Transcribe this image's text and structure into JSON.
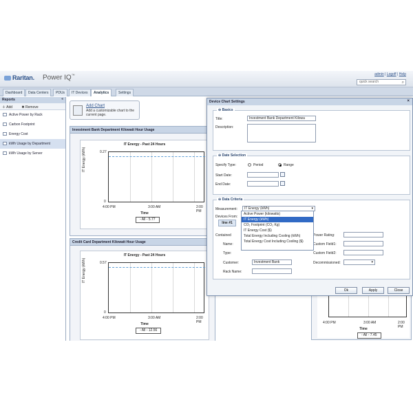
{
  "header": {
    "brand": "Raritan.",
    "product": "Power IQ",
    "trademark": "™",
    "links": [
      "admin",
      "Logoff",
      "Help"
    ],
    "search_placeholder": "quick search"
  },
  "tabs": [
    "Dashboard",
    "Data Centers",
    "PDUs",
    "IT Devices",
    "Analytics",
    "Settings"
  ],
  "sidebar": {
    "title": "Reports",
    "toolbar": {
      "add": "Add",
      "remove": "Remove"
    },
    "items": [
      "Active Power by Rack",
      "Carbon Footprint",
      "Energy Cost",
      "kWh Usage by Department",
      "kWh Usage by Server"
    ]
  },
  "add_chart": {
    "title": "Add Chart",
    "description": "Add a customizable chart to the current page."
  },
  "panels": [
    {
      "title": "Investment Bank Department Kilowatt Hour Usage",
      "chart_title": "IT Energy - Past 24 Hours",
      "y_label": "IT Energy (kWh)",
      "x_label": "Time",
      "y_ticks": [
        "0.27",
        "0"
      ],
      "x_ticks": [
        "4:00 PM",
        "3:00 AM",
        "2:00 PM"
      ],
      "summary": "- All - 5.77"
    },
    {
      "title": "Credit Card Department Kilowatt Hour Usage",
      "chart_title": "IT Energy - Past 24 Hours",
      "y_label": "IT Energy (kWh)",
      "x_label": "Time",
      "y_ticks": [
        "0.57",
        "0"
      ],
      "x_ticks": [
        "4:00 PM",
        "3:00 AM",
        "2:00 PM"
      ],
      "summary": "- All - 12.56"
    }
  ],
  "right_panel": {
    "x_ticks": [
      "4:00 PM",
      "3:00 AM",
      "2:00 PM"
    ],
    "x_label": "Time",
    "summary": "- All - 7.45"
  },
  "dialog": {
    "title": "Device Chart Settings",
    "basics": {
      "title": "Basics",
      "title_label": "Title:",
      "title_value": "Investment Bank Department Kilowa",
      "description_label": "Description:"
    },
    "date_selection": {
      "title": "Date Selection",
      "specify_type": "Specify Type:",
      "period": "Period",
      "range": "Range",
      "start_date": "Start Date:",
      "end_date": "End Date:"
    },
    "data_criteria": {
      "title": "Data Criteria",
      "measurement_label": "Measurement:",
      "measurement_value": "IT Energy (kWh)",
      "devices_from": "Devices From:",
      "line_tab": "line #1",
      "contained": "Contained",
      "name": "Name:",
      "type": "Type:",
      "customer": "Customer:",
      "customer_value": "Investment Bank",
      "rack_name": "Rack Name:",
      "power_rating": "Power Rating:",
      "custom_field1": "Custom Field1:",
      "custom_field2": "Custom Field2:",
      "decommissioned": "Decommissioned:"
    },
    "dropdown_options": [
      "Active Power (kilowatts)",
      "IT Energy (kWh)",
      "CO₂ Footprint (CO₂ Kg)",
      "IT Energy Cost ($)",
      "Total Energy Including Cooling (kWh)",
      "Total Energy Cost Including Cooling ($)"
    ],
    "buttons": {
      "ok": "Ok",
      "apply": "Apply",
      "close": "Close"
    }
  }
}
